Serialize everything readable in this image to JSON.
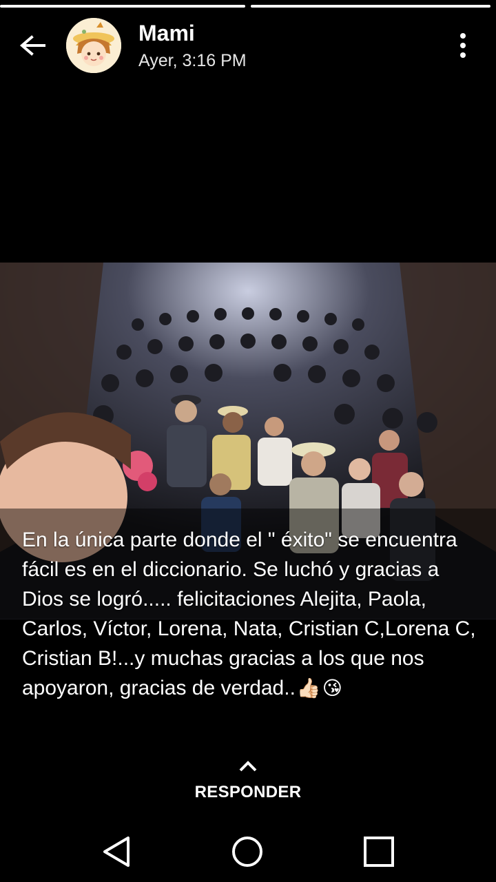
{
  "header": {
    "contact_name": "Mami",
    "timestamp": "Ayer, 3:16 PM",
    "back_icon": "arrow-left-icon",
    "menu_icon": "more-vertical-icon",
    "avatar": "cartoon-girl-avatar"
  },
  "progress": {
    "segments": 2,
    "current": 2
  },
  "status": {
    "caption": "En la única parte donde el \" éxito\" se encuentra fácil es en el diccionario. Se luchó y gracias a Dios se logró..... felicitaciones Alejita, Paola, Carlos, Víctor, Lorena, Nata, Cristian C,Lorena C, Cristian B!...y muchas gracias a los que nos apoyaron, gracias de verdad..",
    "emoji_1": "👍🏻",
    "emoji_2": "😘",
    "photo": "group selfie of a theater cast in front of the audience"
  },
  "reply": {
    "label": "RESPONDER",
    "icon": "chevron-up-icon"
  },
  "navbar": {
    "back_icon": "triangle-back-icon",
    "home_icon": "circle-home-icon",
    "recents_icon": "square-recents-icon"
  },
  "colors": {
    "background": "#000000",
    "text": "#ffffff"
  }
}
